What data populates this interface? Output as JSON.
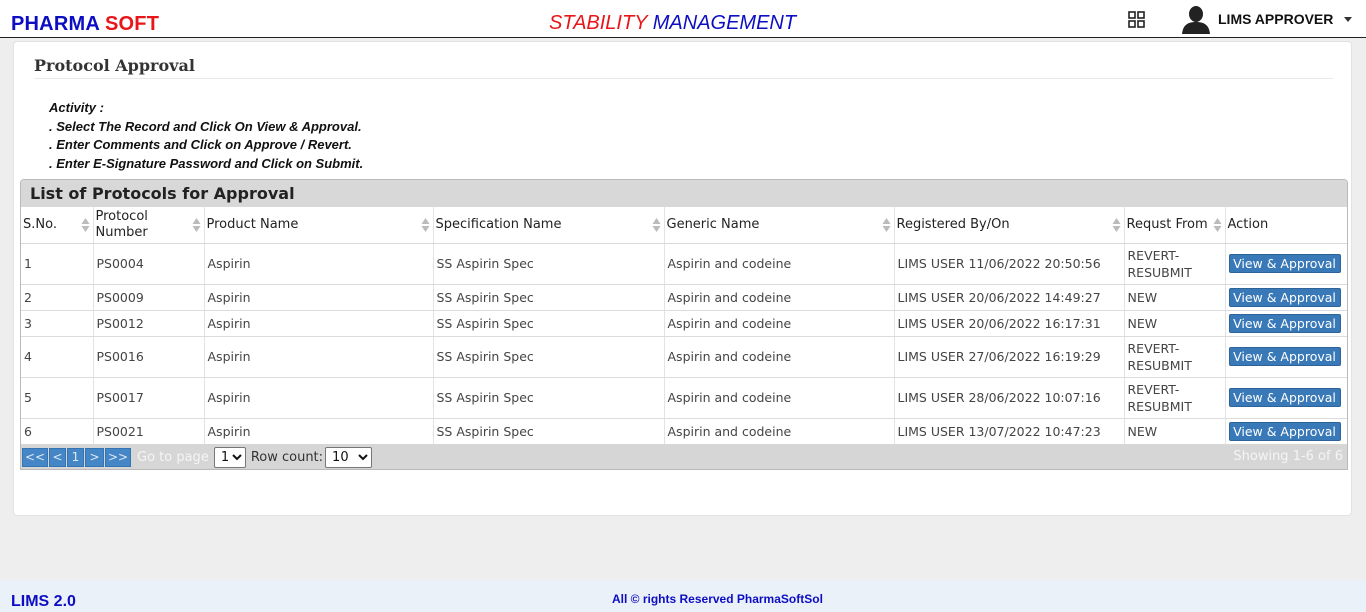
{
  "header": {
    "brand_part1": "PHARMA",
    "brand_part2": "SOFT",
    "app_title_part1": "STABILITY",
    "app_title_part2": "MANAGEMENT",
    "user_name": "LIMS APPROVER",
    "icons": {
      "apps": "grid-icon",
      "user": "user-avatar-icon",
      "menu": "chevron-down-icon"
    }
  },
  "page": {
    "title": "Protocol Approval",
    "activity": {
      "heading": "Activity :",
      "steps": [
        ". Select The Record and Click On View & Approval.",
        ". Enter Comments and Click on Approve / Revert.",
        ". Enter E-Signature Password and Click on Submit."
      ]
    }
  },
  "grid": {
    "caption": "List of Protocols for Approval",
    "columns": [
      "S.No.",
      "Protocol Number",
      "Product Name",
      "Specification Name",
      "Generic Name",
      "Registered By/On",
      "Requst From",
      "Action"
    ],
    "rows": [
      {
        "sno": "1",
        "protocol": "PS0004",
        "product": "Aspirin",
        "spec": "SS Aspirin Spec",
        "generic": "Aspirin and codeine",
        "registered": "LIMS USER 11/06/2022 20:50:56",
        "from": "REVERT-RESUBMIT",
        "action": "View & Approval"
      },
      {
        "sno": "2",
        "protocol": "PS0009",
        "product": "Aspirin",
        "spec": "SS Aspirin Spec",
        "generic": "Aspirin and codeine",
        "registered": "LIMS USER 20/06/2022 14:49:27",
        "from": "NEW",
        "action": "View & Approval"
      },
      {
        "sno": "3",
        "protocol": "PS0012",
        "product": "Aspirin",
        "spec": "SS Aspirin Spec",
        "generic": "Aspirin and codeine",
        "registered": "LIMS USER 20/06/2022 16:17:31",
        "from": "NEW",
        "action": "View & Approval"
      },
      {
        "sno": "4",
        "protocol": "PS0016",
        "product": "Aspirin",
        "spec": "SS Aspirin Spec",
        "generic": "Aspirin and codeine",
        "registered": "LIMS USER 27/06/2022 16:19:29",
        "from": "REVERT-RESUBMIT",
        "action": "View & Approval"
      },
      {
        "sno": "5",
        "protocol": "PS0017",
        "product": "Aspirin",
        "spec": "SS Aspirin Spec",
        "generic": "Aspirin and codeine",
        "registered": "LIMS USER 28/06/2022 10:07:16",
        "from": "REVERT-RESUBMIT",
        "action": "View & Approval"
      },
      {
        "sno": "6",
        "protocol": "PS0021",
        "product": "Aspirin",
        "spec": "SS Aspirin Spec",
        "generic": "Aspirin and codeine",
        "registered": "LIMS USER 13/07/2022 10:47:23",
        "from": "NEW",
        "action": "View & Approval"
      }
    ],
    "pager": {
      "first": "<<",
      "prev": "<",
      "current_page": "1",
      "next": ">",
      "last": ">>",
      "goto_label": "Go to page",
      "goto_value": "1",
      "rowcount_label": "Row count:",
      "rowcount_value": "10",
      "showing": "Showing 1-6 of 6"
    }
  },
  "footer": {
    "version": "LIMS 2.0",
    "copyright": "All © rights Reserved PharmaSoftSol"
  },
  "colors": {
    "brand_blue": "#0d0dc4",
    "brand_red": "#e8161a",
    "button_blue": "#3a79b8"
  }
}
